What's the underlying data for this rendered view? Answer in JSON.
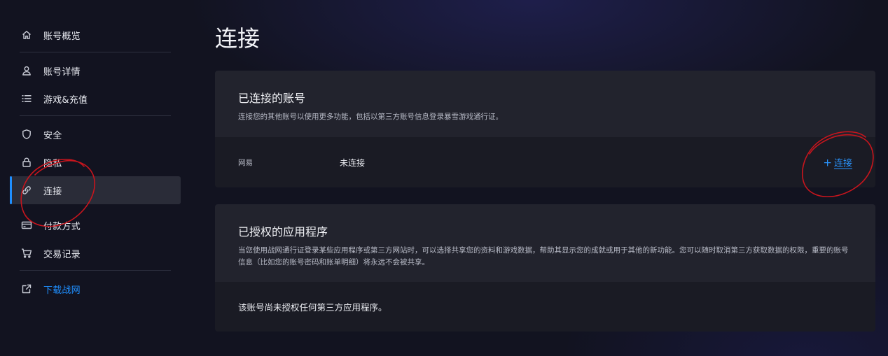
{
  "sidebar": {
    "items": [
      {
        "label": "账号概览",
        "icon": "home-icon"
      },
      {
        "label": "账号详情",
        "icon": "user-icon"
      },
      {
        "label": "游戏&充值",
        "icon": "list-icon"
      },
      {
        "label": "安全",
        "icon": "shield-icon"
      },
      {
        "label": "隐私",
        "icon": "lock-icon"
      },
      {
        "label": "连接",
        "icon": "link-icon",
        "active": true
      },
      {
        "label": "付款方式",
        "icon": "credit-card-icon"
      },
      {
        "label": "交易记录",
        "icon": "cart-icon"
      },
      {
        "label": "下载战网",
        "icon": "external-link-icon"
      }
    ]
  },
  "main": {
    "title": "连接",
    "connected_accounts": {
      "title": "已连接的账号",
      "description": "连接您的其他账号以使用更多功能，包括以第三方账号信息登录暴雪游戏通行证。",
      "provider": {
        "name": "网易",
        "status": "未连接",
        "action_plus": "+",
        "action_label": "连接"
      }
    },
    "authorized_apps": {
      "title": "已授权的应用程序",
      "description": "当您使用战网通行证登录某些应用程序或第三方网站时，可以选择共享您的资料和游戏数据，帮助其显示您的成就或用于其他的新功能。您可以随时取消第三方获取数据的权限，重要的账号信息（比如您的账号密码和账单明细）将永远不会被共享。",
      "empty_text": "该账号尚未授权任何第三方应用程序。"
    }
  },
  "colors": {
    "accent": "#1f8fff",
    "annotation": "#c8151d",
    "card_header": "#22232d",
    "card_body": "#1a1b24",
    "active_item": "#2a2c38"
  }
}
